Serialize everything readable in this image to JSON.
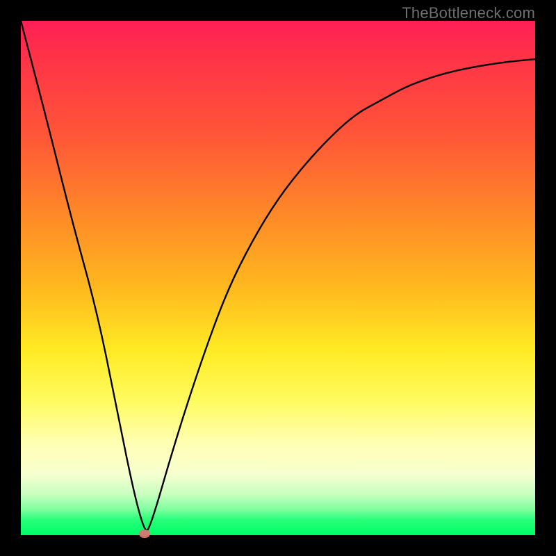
{
  "watermark": "TheBottleneck.com",
  "chart_data": {
    "type": "line",
    "title": "",
    "xlabel": "",
    "ylabel": "",
    "xlim": [
      0,
      100
    ],
    "ylim": [
      0,
      110
    ],
    "grid": false,
    "legend": false,
    "series": [
      {
        "name": "curve",
        "x": [
          0,
          5,
          10,
          15,
          19,
          22,
          24,
          25,
          30,
          35,
          40,
          45,
          50,
          55,
          60,
          65,
          70,
          75,
          80,
          85,
          90,
          95,
          100
        ],
        "y": [
          110,
          89,
          67,
          47,
          25,
          9,
          1,
          1,
          20,
          37,
          52,
          63,
          72,
          79,
          85,
          90,
          93,
          96,
          98,
          99.5,
          100.5,
          101.3,
          101.8
        ]
      }
    ],
    "marker": {
      "x": 24,
      "y": 0
    },
    "background_gradient": {
      "stops": [
        {
          "pos": 0.0,
          "color": "#ff1e55"
        },
        {
          "pos": 0.22,
          "color": "#ff5538"
        },
        {
          "pos": 0.52,
          "color": "#ffea24"
        },
        {
          "pos": 0.88,
          "color": "#f7ffd0"
        },
        {
          "pos": 1.0,
          "color": "#00ff66"
        }
      ]
    },
    "curve_color": "#000000",
    "marker_color": "#d87773"
  }
}
